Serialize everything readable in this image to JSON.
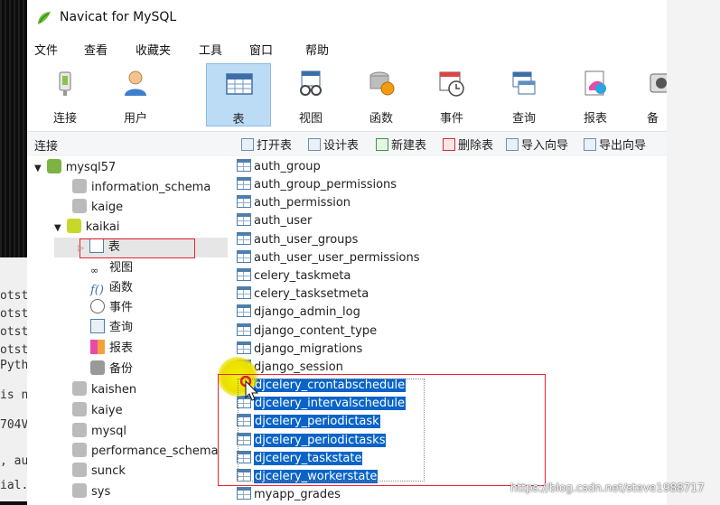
{
  "window": {
    "title": "Navicat for MySQL"
  },
  "menu": [
    "文件",
    "查看",
    "收藏夹",
    "工具",
    "窗口",
    "帮助"
  ],
  "toolbar": [
    {
      "label": "连接",
      "icon": "connection-plug-icon",
      "active": false
    },
    {
      "label": "用户",
      "icon": "user-icon",
      "active": false
    },
    {
      "label": "表",
      "icon": "table-icon",
      "active": true
    },
    {
      "label": "视图",
      "icon": "view-glasses-icon",
      "active": false
    },
    {
      "label": "函数",
      "icon": "function-icon",
      "active": false
    },
    {
      "label": "事件",
      "icon": "event-clock-icon",
      "active": false
    },
    {
      "label": "查询",
      "icon": "query-icon",
      "active": false
    },
    {
      "label": "报表",
      "icon": "report-icon",
      "active": false
    },
    {
      "label": "备",
      "icon": "backup-icon",
      "active": false
    }
  ],
  "subbar": {
    "connection_label": "连接",
    "actions": [
      "打开表",
      "设计表",
      "新建表",
      "删除表",
      "导入向导",
      "导出向导"
    ]
  },
  "tree": {
    "connection": "mysql57",
    "databases_before": [
      "information_schema",
      "kaige"
    ],
    "open_database": "kaikai",
    "children": [
      "表",
      "视图",
      "函数",
      "事件",
      "查询",
      "报表",
      "备份"
    ],
    "databases_after": [
      "kaishen",
      "kaiye",
      "mysql",
      "performance_schema",
      "sunck",
      "sys"
    ]
  },
  "tables": [
    {
      "name": "auth_group",
      "selected": false
    },
    {
      "name": "auth_group_permissions",
      "selected": false
    },
    {
      "name": "auth_permission",
      "selected": false
    },
    {
      "name": "auth_user",
      "selected": false
    },
    {
      "name": "auth_user_groups",
      "selected": false
    },
    {
      "name": "auth_user_user_permissions",
      "selected": false
    },
    {
      "name": "celery_taskmeta",
      "selected": false
    },
    {
      "name": "celery_tasksetmeta",
      "selected": false
    },
    {
      "name": "django_admin_log",
      "selected": false
    },
    {
      "name": "django_content_type",
      "selected": false
    },
    {
      "name": "django_migrations",
      "selected": false
    },
    {
      "name": "django_session",
      "selected": false
    },
    {
      "name": "djcelery_crontabschedule",
      "selected": true
    },
    {
      "name": "djcelery_intervalschedule",
      "selected": true
    },
    {
      "name": "djcelery_periodictask",
      "selected": true
    },
    {
      "name": "djcelery_periodictasks",
      "selected": true
    },
    {
      "name": "djcelery_taskstate",
      "selected": true
    },
    {
      "name": "djcelery_workerstate",
      "selected": true
    },
    {
      "name": "myapp_grades",
      "selected": false
    }
  ],
  "terminal": {
    "lines_top": [
      "otst",
      "otst",
      "otst",
      "otst",
      "Pyth"
    ],
    "lines_bottom": [
      "is n",
      "704V",
      ", au",
      "ial."
    ]
  },
  "watermark": "https://blog.csdn.net/steve1988717",
  "colors": {
    "selection": "#0a64c8",
    "active_tool": "#bcdcf6",
    "annotation": "#e22233"
  }
}
